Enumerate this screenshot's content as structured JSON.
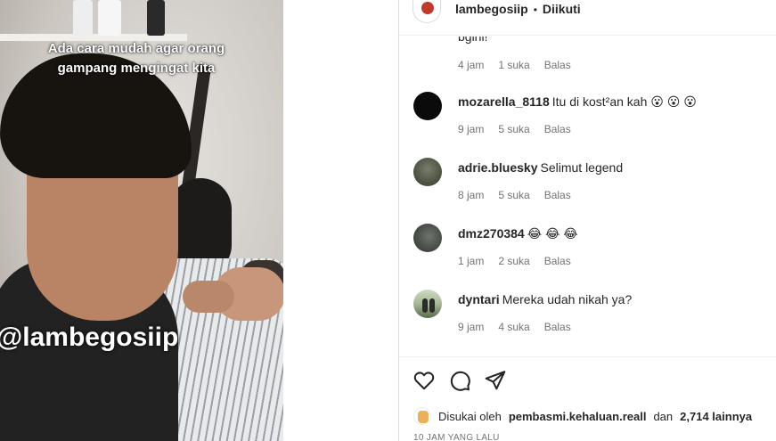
{
  "media": {
    "overlay_text": "Ada cara mudah agar orang gampang mengingat kita",
    "watermark": "@lambegosiip"
  },
  "header": {
    "username": "lambegosiip",
    "separator": "•",
    "follow_status": "Diikuti"
  },
  "partial_comment": {
    "text": "bgini!",
    "time": "4 jam",
    "likes": "1 suka",
    "reply": "Balas"
  },
  "comments": [
    {
      "username": "mozarella_8118",
      "text": "Itu di kost²an kah 😮 😮 😮",
      "time": "9 jam",
      "likes": "5 suka",
      "reply": "Balas"
    },
    {
      "username": "adrie.bluesky",
      "text": "Selimut legend",
      "time": "8 jam",
      "likes": "5 suka",
      "reply": "Balas"
    },
    {
      "username": "dmz270384",
      "text": "😂 😂 😂",
      "time": "1 jam",
      "likes": "2 suka",
      "reply": "Balas"
    },
    {
      "username": "dyntari",
      "text": "Mereka udah nikah ya?",
      "time": "9 jam",
      "likes": "4 suka",
      "reply": "Balas"
    }
  ],
  "actions": {
    "like_icon": "heart-icon",
    "comment_icon": "comment-icon",
    "share_icon": "share-icon"
  },
  "likes": {
    "prefix": "Disukai oleh",
    "user": "pembasmi.kehaluan.reall",
    "joiner": "dan",
    "count": "2,714 lainnya"
  },
  "timestamp": "10 JAM YANG LALU"
}
